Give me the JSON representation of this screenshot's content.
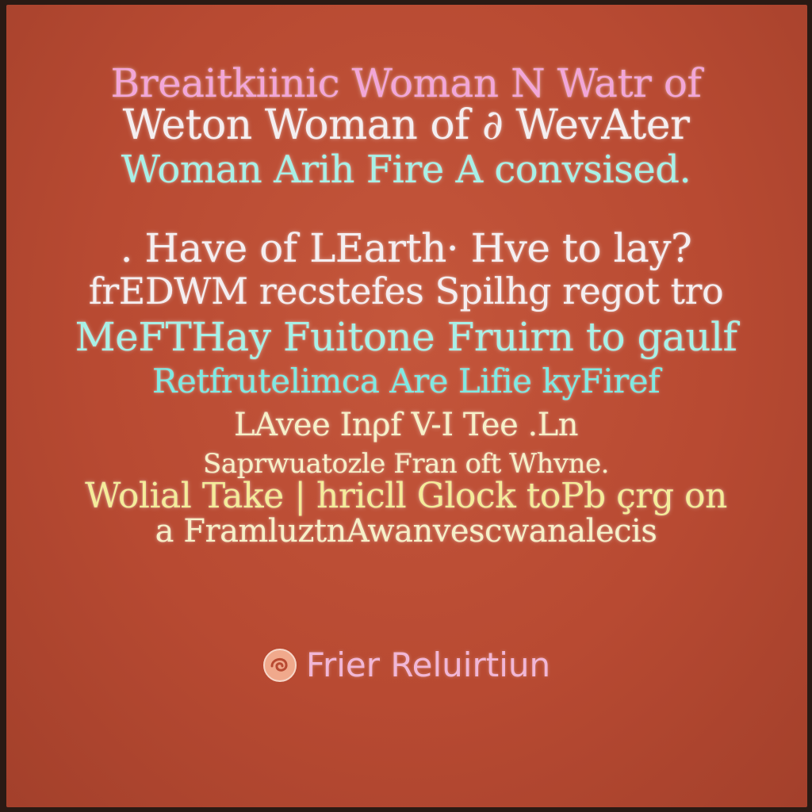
{
  "poster": {
    "lines": [
      {
        "segments": [
          {
            "text": "Breaitkiinic Woman N Watr of"
          }
        ]
      },
      {
        "segments": [
          {
            "text": "Weton Woman of ∂ WevAter"
          }
        ]
      },
      {
        "segments": [
          {
            "text": "Woman Arih Fire A convsised."
          }
        ]
      },
      {
        "segments": [
          {
            "text": ". Have of LEarth· Hve to lay?"
          }
        ]
      },
      {
        "segments": [
          {
            "text": "frEDWM recstefes Spilhg regot tro"
          }
        ]
      },
      {
        "segments": [
          {
            "text": "MeFTHay Fuitone Fruirn to gaulf"
          }
        ]
      },
      {
        "segments": [
          {
            "text": "Retfrutelimca Are Lifie kyFiref"
          }
        ]
      },
      {
        "segments": [
          {
            "text": "LAvee Inρf V-I Tee .Ln"
          }
        ]
      },
      {
        "segments": [
          {
            "text": "Saprwuatozle Fran oft Whvne."
          }
        ]
      },
      {
        "segments": [
          {
            "text": "Wolial Take | hricll Glock toPb çrg on"
          }
        ]
      },
      {
        "segments": [
          {
            "text": "a FramluztnAwanvescwanalecis"
          }
        ]
      }
    ],
    "footer_text": "Frier Reluirtiun",
    "colors": {
      "background": "#b84a32",
      "pink": "#f2a6d8",
      "white": "#f4eef0",
      "mint": "#a8f0e6",
      "cyan": "#7fe9e2",
      "cream": "#f6f0c8",
      "yellow": "#f4ec9a",
      "rose": "#f1b6d6"
    },
    "logo_icon": "swirl-emblem-icon"
  }
}
